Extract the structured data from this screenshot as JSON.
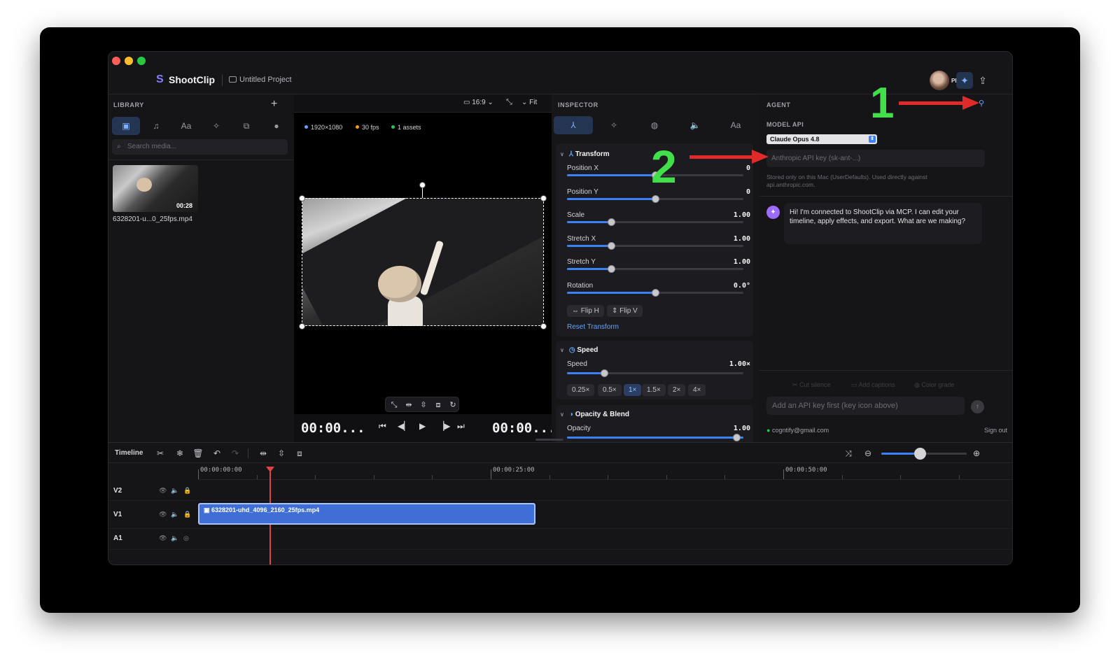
{
  "app": {
    "name": "ShootClip",
    "project": "Untitled Project",
    "pro_badge": "PRO"
  },
  "library": {
    "title": "LIBRARY",
    "add": "+",
    "search_placeholder": "Search media...",
    "items": [
      {
        "name": "6328201-u...0_25fps.mp4",
        "duration": "00:28"
      }
    ]
  },
  "viewer": {
    "aspect": "16:9",
    "fit": "Fit",
    "meta": {
      "resolution": "1920×1080",
      "fps": "30 fps",
      "assets": "1 assets"
    },
    "timecode_current": "00:00...",
    "timecode_total": "00:00..."
  },
  "inspector": {
    "title": "INSPECTOR",
    "transform": {
      "title": "Transform",
      "rows": [
        {
          "label": "Position X",
          "value": "0",
          "level": 0.5
        },
        {
          "label": "Position Y",
          "value": "0",
          "level": 0.5
        },
        {
          "label": "Scale",
          "value": "1.00",
          "level": 0.25
        },
        {
          "label": "Stretch X",
          "value": "1.00",
          "level": 0.25
        },
        {
          "label": "Stretch Y",
          "value": "1.00",
          "level": 0.25
        },
        {
          "label": "Rotation",
          "value": "0.0°",
          "level": 0.5
        }
      ],
      "flip_h": "⇔ Flip H",
      "flip_v": "⇕ Flip V",
      "reset": "Reset Transform"
    },
    "speed": {
      "title": "Speed",
      "label": "Speed",
      "value": "1.00×",
      "level": 0.21,
      "presets": [
        "0.25×",
        "0.5×",
        "1×",
        "1.5×",
        "2×",
        "4×"
      ],
      "active": "1×"
    },
    "opacity": {
      "title": "Opacity & Blend",
      "label": "Opacity",
      "value": "1.00",
      "level": 1.0
    }
  },
  "agent": {
    "title": "AGENT",
    "model_label": "MODEL API",
    "model": "Claude Opus 4.8",
    "api_placeholder": "Anthropic API key (sk-ant-...)",
    "note": "Stored only on this Mac (UserDefaults). Used directly against api.anthropic.com.",
    "message": "Hi! I'm connected to ShootClip via MCP. I can edit your timeline, apply effects, and export. What are we making?",
    "suggestions": [
      "Cut silence",
      "Add captions",
      "Color grade"
    ],
    "chat_placeholder": "Add an API key first (key icon above)",
    "email": "cogntify@gmail.com",
    "sign_out": "Sign out"
  },
  "timeline": {
    "title": "Timeline",
    "ruler": [
      "00:00:00:00",
      "00:00:25:00",
      "00:00:50:00"
    ],
    "tracks": [
      "V2",
      "V1",
      "A1"
    ],
    "clip": "6328201-uhd_4096_2160_25fps.mp4"
  },
  "annotations": {
    "one": "1",
    "two": "2"
  },
  "colors": {
    "accent": "#3b82f6",
    "playhead": "#e04343",
    "annotation_number": "#41e04a",
    "annotation_arrow": "#e02a2a"
  }
}
